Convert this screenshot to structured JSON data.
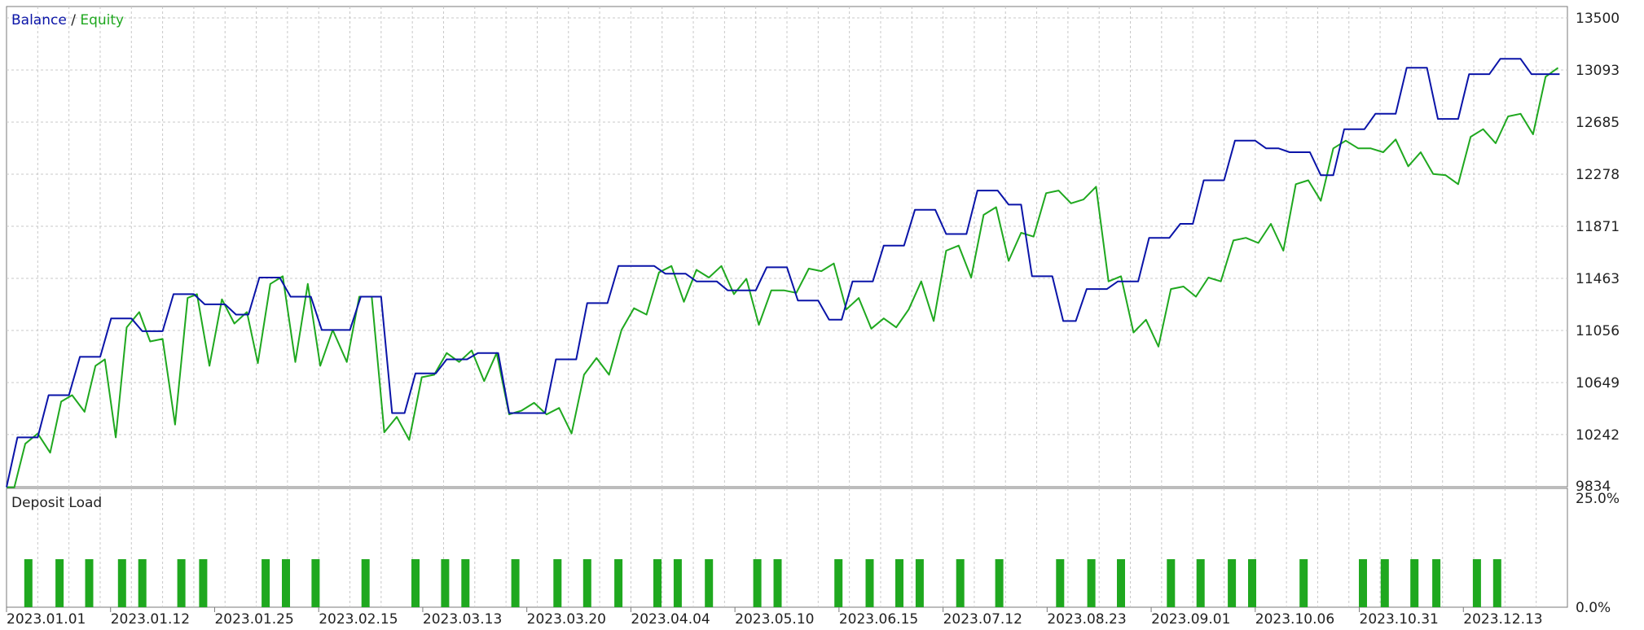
{
  "chart_data": [
    {
      "type": "line",
      "legend": [
        "Balance",
        "Equity"
      ],
      "legend_separator": " / ",
      "legend_position": "top-left",
      "colors": {
        "balance": "#0a14a8",
        "equity": "#1fa81f",
        "grid": "#c8c8c8"
      },
      "grid": true,
      "y_ticks": [
        "13500",
        "13093",
        "12685",
        "12278",
        "11871",
        "11463",
        "11056",
        "10649",
        "10242",
        "9834"
      ],
      "ylim": [
        9834,
        13500
      ],
      "xlim": [
        0,
        100
      ],
      "x_tick_labels": [
        "2023.01.01",
        "2023.01.12",
        "2023.01.25",
        "2023.02.15",
        "2023.03.13",
        "2023.03.20",
        "2023.04.04",
        "2023.05.10",
        "2023.06.15",
        "2023.07.12",
        "2023.08.23",
        "2023.09.01",
        "2023.10.06",
        "2023.10.31",
        "2023.12.13"
      ],
      "series": [
        {
          "name": "Balance",
          "points": [
            [
              0,
              9830
            ],
            [
              0.7,
              10220
            ],
            [
              2,
              10220
            ],
            [
              2.7,
              10550
            ],
            [
              4,
              10550
            ],
            [
              4.7,
              10850
            ],
            [
              6,
              10850
            ],
            [
              6.7,
              11150
            ],
            [
              8,
              11150
            ],
            [
              8.7,
              11050
            ],
            [
              10,
              11050
            ],
            [
              10.7,
              11340
            ],
            [
              12,
              11340
            ],
            [
              12.7,
              11260
            ],
            [
              14,
              11260
            ],
            [
              14.7,
              11180
            ],
            [
              15.5,
              11180
            ],
            [
              16.2,
              11470
            ],
            [
              17.5,
              11470
            ],
            [
              18.2,
              11320
            ],
            [
              19.5,
              11320
            ],
            [
              20.2,
              11060
            ],
            [
              22,
              11060
            ],
            [
              22.7,
              11320
            ],
            [
              24,
              11320
            ],
            [
              24.7,
              10410
            ],
            [
              25.5,
              10410
            ],
            [
              26.2,
              10720
            ],
            [
              27.5,
              10720
            ],
            [
              28.2,
              10830
            ],
            [
              29.5,
              10830
            ],
            [
              30.2,
              10880
            ],
            [
              31.5,
              10880
            ],
            [
              32.2,
              10410
            ],
            [
              34.5,
              10410
            ],
            [
              35.2,
              10830
            ],
            [
              36.5,
              10830
            ],
            [
              37.2,
              11270
            ],
            [
              38.5,
              11270
            ],
            [
              39.2,
              11560
            ],
            [
              41.5,
              11560
            ],
            [
              42.2,
              11500
            ],
            [
              43.5,
              11500
            ],
            [
              44.2,
              11440
            ],
            [
              45.5,
              11440
            ],
            [
              46.2,
              11370
            ],
            [
              48,
              11370
            ],
            [
              48.7,
              11550
            ],
            [
              50,
              11550
            ],
            [
              50.7,
              11290
            ],
            [
              52,
              11290
            ],
            [
              52.7,
              11140
            ],
            [
              53.5,
              11140
            ],
            [
              54.2,
              11440
            ],
            [
              55.5,
              11440
            ],
            [
              56.2,
              11720
            ],
            [
              57.5,
              11720
            ],
            [
              58.2,
              12000
            ],
            [
              59.5,
              12000
            ],
            [
              60.2,
              11810
            ],
            [
              61.5,
              11810
            ],
            [
              62.2,
              12150
            ],
            [
              63.5,
              12150
            ],
            [
              64.2,
              12040
            ],
            [
              65,
              12040
            ],
            [
              65.7,
              11480
            ],
            [
              67,
              11480
            ],
            [
              67.7,
              11130
            ],
            [
              68.5,
              11130
            ],
            [
              69.2,
              11380
            ],
            [
              70.5,
              11380
            ],
            [
              71.2,
              11440
            ],
            [
              72.5,
              11440
            ],
            [
              73.2,
              11780
            ],
            [
              74.5,
              11780
            ],
            [
              75.2,
              11890
            ],
            [
              76,
              11890
            ],
            [
              76.7,
              12230
            ],
            [
              78,
              12230
            ],
            [
              78.7,
              12540
            ],
            [
              80,
              12540
            ],
            [
              80.7,
              12480
            ],
            [
              81.5,
              12480
            ],
            [
              82.2,
              12450
            ],
            [
              83.5,
              12450
            ],
            [
              84.2,
              12270
            ],
            [
              85,
              12270
            ],
            [
              85.7,
              12630
            ],
            [
              87,
              12630
            ],
            [
              87.7,
              12750
            ],
            [
              89,
              12750
            ],
            [
              89.7,
              13110
            ],
            [
              91,
              13110
            ],
            [
              91.7,
              12710
            ],
            [
              93,
              12710
            ],
            [
              93.7,
              13060
            ],
            [
              95,
              13060
            ],
            [
              95.7,
              13180
            ],
            [
              97,
              13180
            ],
            [
              97.7,
              13060
            ],
            [
              99.5,
              13060
            ]
          ]
        },
        {
          "name": "Equity",
          "points": [
            [
              0,
              9830
            ],
            [
              0.5,
              9830
            ],
            [
              1.2,
              10170
            ],
            [
              2,
              10250
            ],
            [
              2.8,
              10100
            ],
            [
              3.5,
              10500
            ],
            [
              4.2,
              10550
            ],
            [
              5,
              10420
            ],
            [
              5.7,
              10780
            ],
            [
              6.3,
              10830
            ],
            [
              7,
              10220
            ],
            [
              7.7,
              11080
            ],
            [
              8.5,
              11200
            ],
            [
              9.2,
              10970
            ],
            [
              10,
              10990
            ],
            [
              10.8,
              10320
            ],
            [
              11.6,
              11310
            ],
            [
              12.2,
              11340
            ],
            [
              13,
              10780
            ],
            [
              13.8,
              11300
            ],
            [
              14.6,
              11110
            ],
            [
              15.4,
              11200
            ],
            [
              16.1,
              10800
            ],
            [
              16.9,
              11420
            ],
            [
              17.7,
              11480
            ],
            [
              18.5,
              10810
            ],
            [
              19.3,
              11420
            ],
            [
              20.1,
              10780
            ],
            [
              20.9,
              11060
            ],
            [
              21.8,
              10810
            ],
            [
              22.6,
              11320
            ],
            [
              23.4,
              11320
            ],
            [
              24.2,
              10260
            ],
            [
              25,
              10380
            ],
            [
              25.8,
              10200
            ],
            [
              26.6,
              10690
            ],
            [
              27.4,
              10710
            ],
            [
              28.2,
              10880
            ],
            [
              29,
              10810
            ],
            [
              29.8,
              10900
            ],
            [
              30.6,
              10660
            ],
            [
              31.4,
              10880
            ],
            [
              32.2,
              10400
            ],
            [
              33,
              10430
            ],
            [
              33.8,
              10490
            ],
            [
              34.6,
              10400
            ],
            [
              35.4,
              10450
            ],
            [
              36.2,
              10250
            ],
            [
              37,
              10710
            ],
            [
              37.8,
              10840
            ],
            [
              38.6,
              10710
            ],
            [
              39.4,
              11060
            ],
            [
              40.2,
              11230
            ],
            [
              41,
              11180
            ],
            [
              41.8,
              11510
            ],
            [
              42.6,
              11560
            ],
            [
              43.4,
              11280
            ],
            [
              44.2,
              11530
            ],
            [
              45,
              11470
            ],
            [
              45.8,
              11560
            ],
            [
              46.6,
              11340
            ],
            [
              47.4,
              11460
            ],
            [
              48.2,
              11100
            ],
            [
              49,
              11370
            ],
            [
              49.8,
              11370
            ],
            [
              50.6,
              11350
            ],
            [
              51.4,
              11540
            ],
            [
              52.2,
              11520
            ],
            [
              53,
              11580
            ],
            [
              53.8,
              11220
            ],
            [
              54.6,
              11310
            ],
            [
              55.4,
              11070
            ],
            [
              56.2,
              11150
            ],
            [
              57,
              11080
            ],
            [
              57.8,
              11220
            ],
            [
              58.6,
              11440
            ],
            [
              59.4,
              11130
            ],
            [
              60.2,
              11680
            ],
            [
              61,
              11720
            ],
            [
              61.8,
              11470
            ],
            [
              62.6,
              11960
            ],
            [
              63.4,
              12020
            ],
            [
              64.2,
              11600
            ],
            [
              65,
              11820
            ],
            [
              65.8,
              11790
            ],
            [
              66.6,
              12130
            ],
            [
              67.4,
              12150
            ],
            [
              68.2,
              12050
            ],
            [
              69,
              12080
            ],
            [
              69.8,
              12180
            ],
            [
              70.6,
              11440
            ],
            [
              71.4,
              11480
            ],
            [
              72.2,
              11040
            ],
            [
              73,
              11140
            ],
            [
              73.8,
              10930
            ],
            [
              74.6,
              11380
            ],
            [
              75.4,
              11400
            ],
            [
              76.2,
              11320
            ],
            [
              77,
              11470
            ],
            [
              77.8,
              11440
            ],
            [
              78.6,
              11760
            ],
            [
              79.4,
              11780
            ],
            [
              80.2,
              11740
            ],
            [
              81,
              11890
            ],
            [
              81.8,
              11680
            ],
            [
              82.6,
              12200
            ],
            [
              83.4,
              12230
            ],
            [
              84.2,
              12070
            ],
            [
              85,
              12480
            ],
            [
              85.8,
              12540
            ],
            [
              86.6,
              12480
            ],
            [
              87.4,
              12480
            ],
            [
              88.2,
              12450
            ],
            [
              89,
              12550
            ],
            [
              89.8,
              12340
            ],
            [
              90.6,
              12450
            ],
            [
              91.4,
              12280
            ],
            [
              92.2,
              12270
            ],
            [
              93,
              12200
            ],
            [
              93.8,
              12570
            ],
            [
              94.6,
              12630
            ],
            [
              95.4,
              12520
            ],
            [
              96.2,
              12730
            ],
            [
              97,
              12750
            ],
            [
              97.8,
              12590
            ],
            [
              98.6,
              13040
            ],
            [
              99.4,
              13110
            ]
          ]
        }
      ]
    },
    {
      "type": "bar",
      "title": "Deposit Load",
      "colors": {
        "bar": "#1fa81f"
      },
      "y_ticks": [
        "25.0%",
        "0.0%"
      ],
      "ylim": [
        0,
        25
      ],
      "xlim": [
        0,
        100
      ],
      "bar_value_percent": 11,
      "bar_x": [
        1.4,
        3.4,
        5.3,
        7.4,
        8.7,
        11.2,
        12.6,
        16.6,
        17.9,
        19.8,
        23,
        26.2,
        28.1,
        29.4,
        32.6,
        35.3,
        37.2,
        39.2,
        41.7,
        43,
        45,
        48.1,
        49.4,
        53.3,
        55.3,
        57.2,
        58.5,
        61.1,
        63.6,
        67.5,
        69.5,
        71.4,
        74.6,
        76.5,
        78.5,
        79.8,
        83.1,
        86.9,
        88.3,
        90.2,
        91.6,
        94.2,
        95.5
      ]
    }
  ]
}
